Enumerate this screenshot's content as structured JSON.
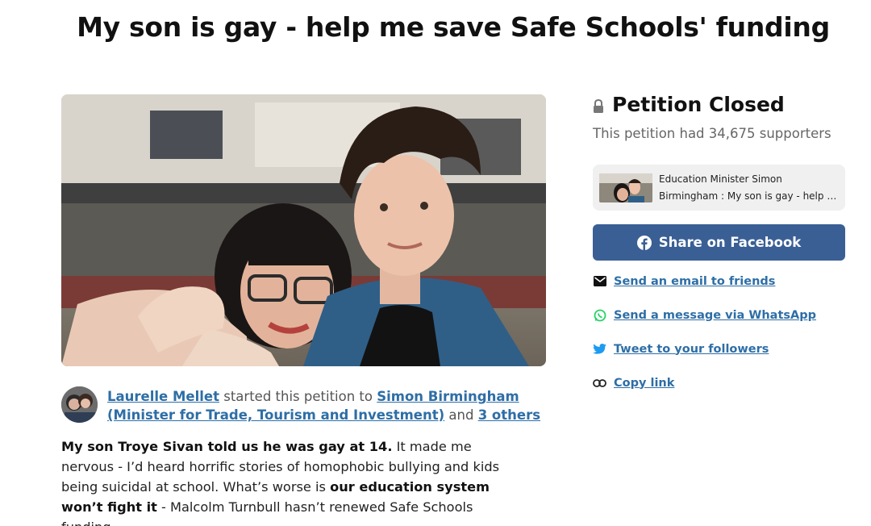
{
  "page": {
    "title": "My son is gay - help me save Safe Schools' funding"
  },
  "starter": {
    "name": "Laurelle Mellet",
    "started_text": "started this petition to",
    "target": "Simon Birmingham (Minister for Trade, Tourism and Investment)",
    "and_text": "and",
    "others": "3 others"
  },
  "body": {
    "bold1": "My son Troye Sivan told us he was gay at 14.",
    "text1": " It made me nervous - I’d heard horrific stories of homophobic bullying and kids being suicidal at school. What’s worse is ",
    "bold2": "our education system won’t fight it",
    "text2": " - Malcolm Turnbull hasn’t renewed Safe Schools funding."
  },
  "sidebar": {
    "status": "Petition Closed",
    "supporters": "This petition had 34,675 supporters",
    "preview": {
      "line1": "Education Minister Simon",
      "line2": "Birmingham : My son is gay - help m..."
    },
    "facebook_label": "Share on Facebook",
    "links": [
      {
        "label": "Send an email to friends",
        "icon": "mail-icon"
      },
      {
        "label": "Send a message via WhatsApp",
        "icon": "whatsapp-icon"
      },
      {
        "label": "Tweet to your followers",
        "icon": "twitter-icon"
      },
      {
        "label": "Copy link",
        "icon": "link-icon"
      }
    ]
  },
  "colors": {
    "link": "#2e6ea6",
    "facebook": "#3a5f95",
    "whatsapp": "#25d366",
    "twitter": "#1d9bf0"
  }
}
